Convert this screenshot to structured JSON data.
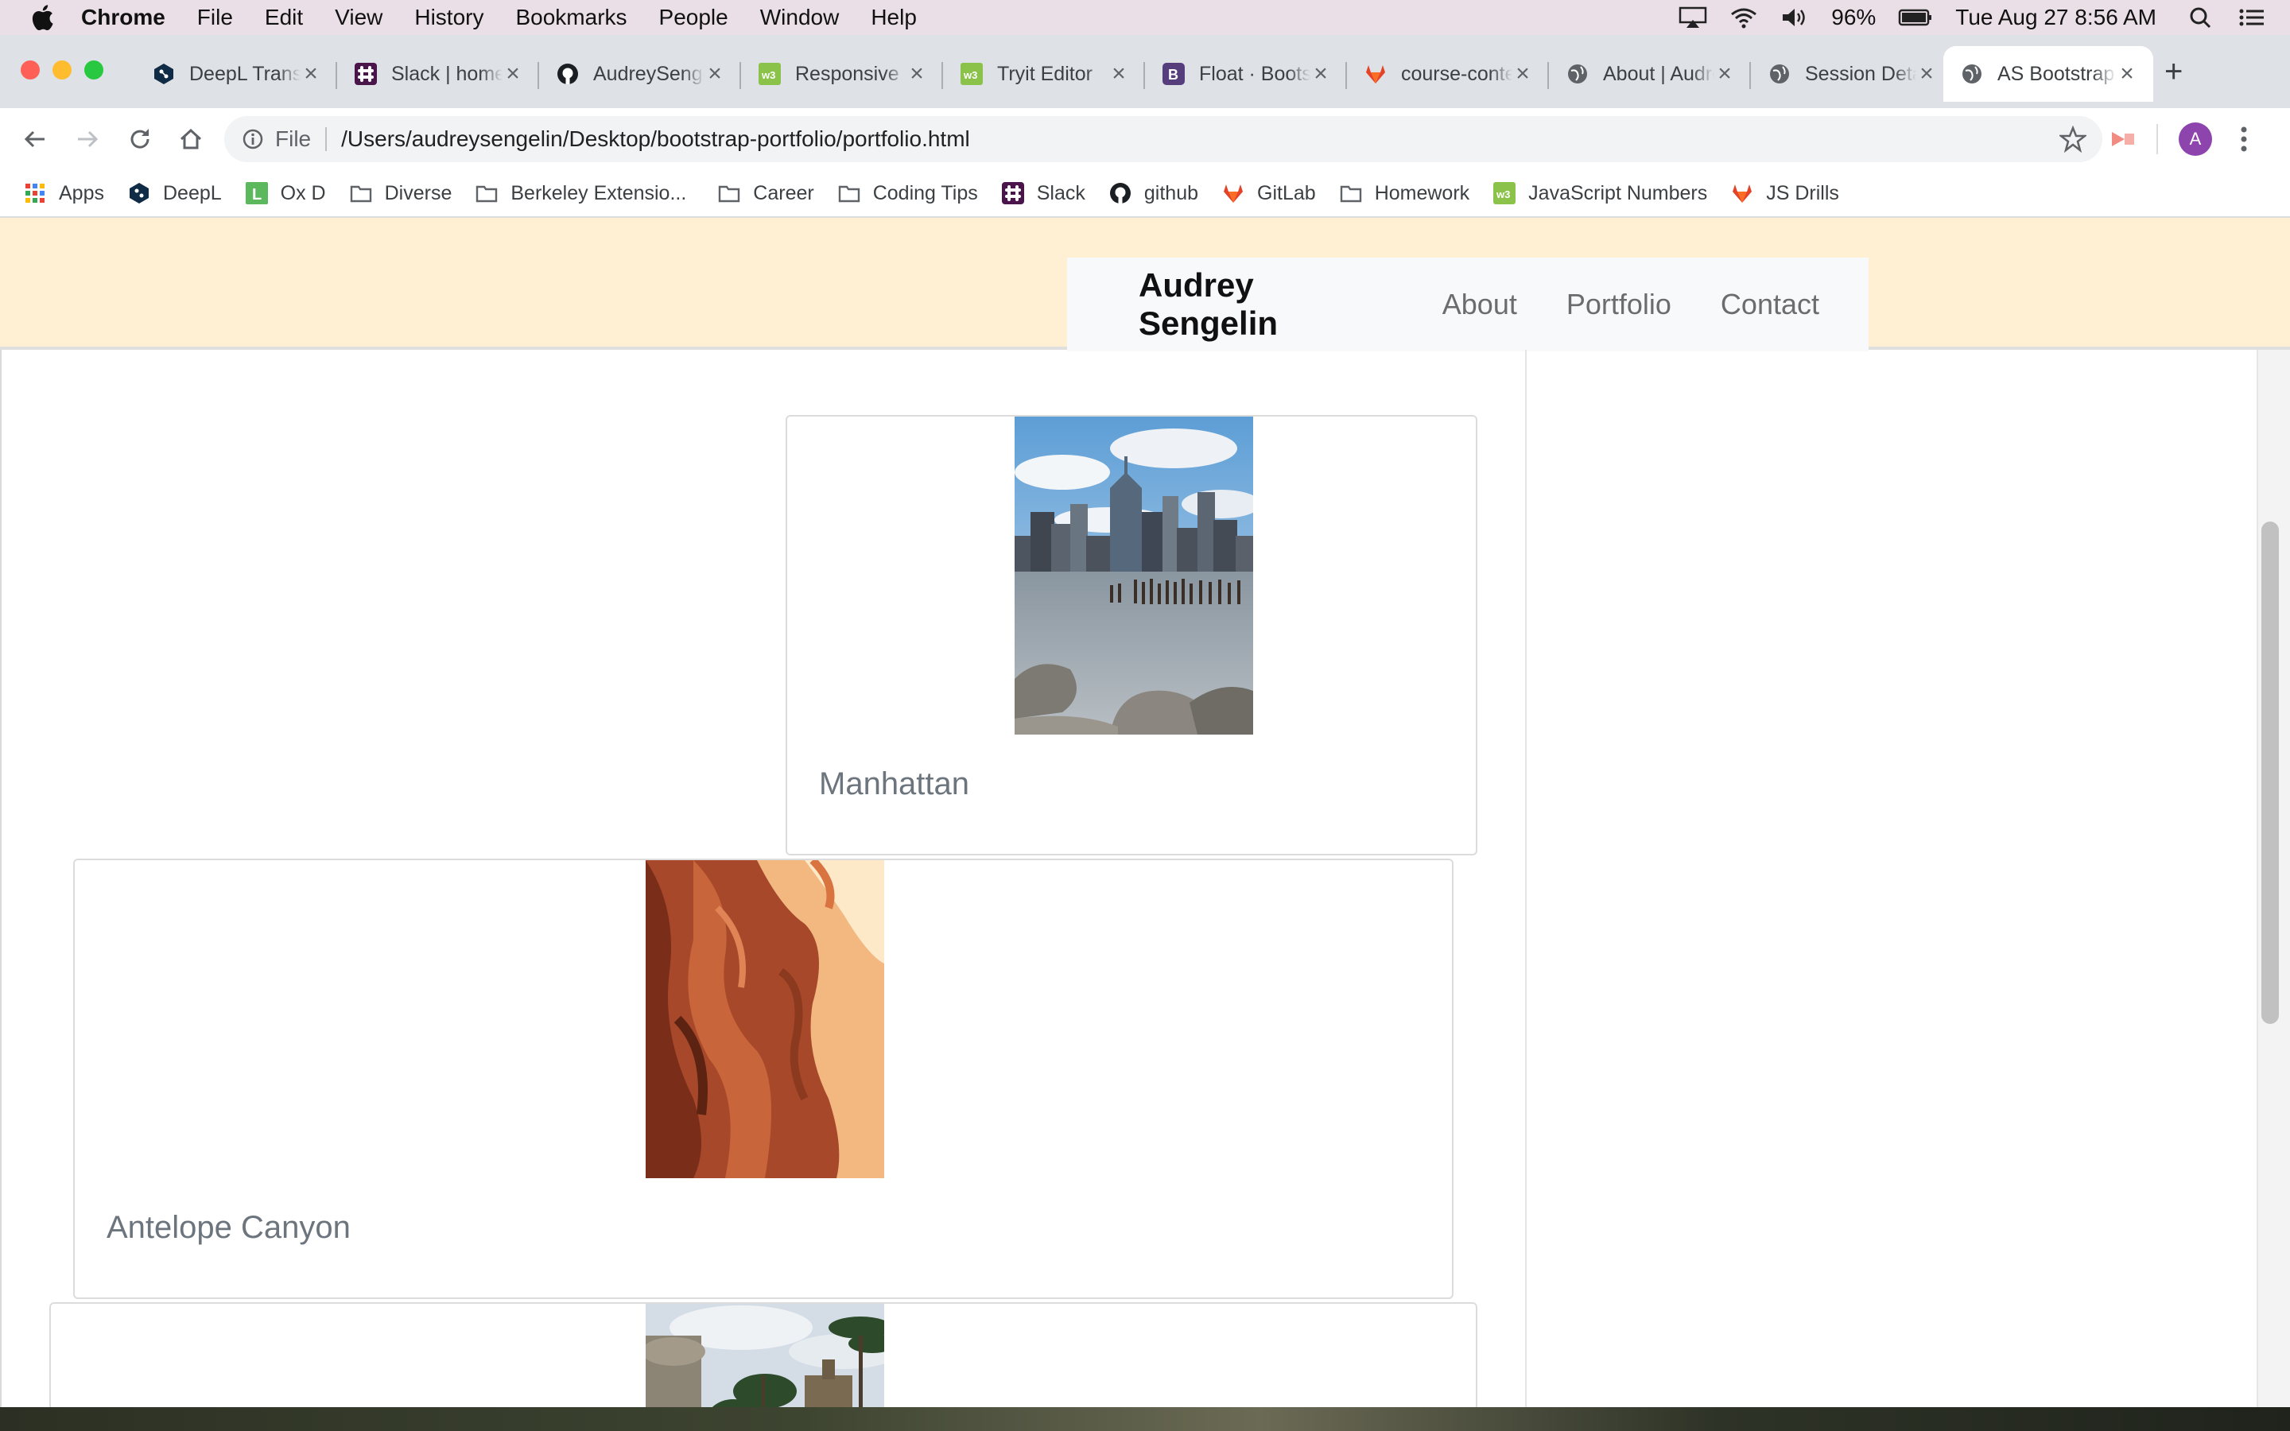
{
  "menubar": {
    "app_name": "Chrome",
    "items": [
      "File",
      "Edit",
      "View",
      "History",
      "Bookmarks",
      "People",
      "Window",
      "Help"
    ],
    "battery": "96%",
    "clock": "Tue Aug 27  8:56 AM"
  },
  "tabs": [
    {
      "title": "DeepL Translator",
      "icon": "deepl-icon"
    },
    {
      "title": "Slack | home",
      "icon": "slack-icon"
    },
    {
      "title": "AudreySengelin",
      "icon": "github-icon"
    },
    {
      "title": "Responsive",
      "icon": "w3schools-icon"
    },
    {
      "title": "Tryit Editor",
      "icon": "w3schools-icon"
    },
    {
      "title": "Float · Bootstrap",
      "icon": "bootstrap-icon"
    },
    {
      "title": "course-content",
      "icon": "gitlab-icon"
    },
    {
      "title": "About | Audrey",
      "icon": "globe-icon"
    },
    {
      "title": "Session Details",
      "icon": "globe-icon"
    },
    {
      "title": "AS Bootstrap",
      "icon": "globe-icon",
      "active": true
    }
  ],
  "address_bar": {
    "scheme": "File",
    "url": "/Users/audreysengelin/Desktop/bootstrap-portfolio/portfolio.html"
  },
  "profile": {
    "initial": "A"
  },
  "bookmarks": [
    {
      "label": "Apps",
      "icon": "apps-grid-icon"
    },
    {
      "label": "DeepL",
      "icon": "deepl-icon"
    },
    {
      "label": "Ox D",
      "icon": "ox-d-icon"
    },
    {
      "label": "Diverse",
      "icon": "folder-icon"
    },
    {
      "label": "Berkeley Extensio...",
      "icon": "folder-icon"
    },
    {
      "label": "Career",
      "icon": "folder-icon"
    },
    {
      "label": "Coding Tips",
      "icon": "folder-icon"
    },
    {
      "label": "Slack",
      "icon": "slack-icon"
    },
    {
      "label": "github",
      "icon": "github-icon"
    },
    {
      "label": "GitLab",
      "icon": "gitlab-icon"
    },
    {
      "label": "Homework",
      "icon": "folder-icon"
    },
    {
      "label": "JavaScript Numbers",
      "icon": "w3schools-icon"
    },
    {
      "label": "JS Drills",
      "icon": "gitlab-icon"
    }
  ],
  "site": {
    "brand": "Audrey Sengelin",
    "nav": [
      "About",
      "Portfolio",
      "Contact"
    ]
  },
  "portfolio": [
    {
      "title": "Manhattan",
      "image": "city skyline photo"
    },
    {
      "title": "Antelope Canyon",
      "image": "canyon photo"
    },
    {
      "title": "",
      "image": "palm trees photo"
    }
  ],
  "colors": {
    "header_bg": "#fff0d4",
    "nav_bg": "#f8f9fa",
    "card_title": "#6c757d"
  }
}
